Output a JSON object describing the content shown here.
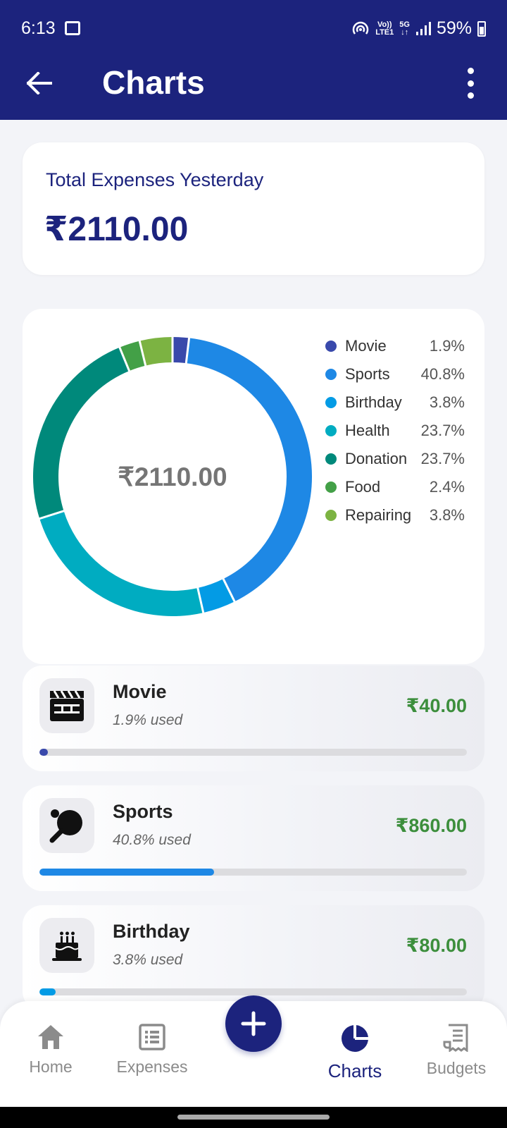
{
  "status_bar": {
    "time": "6:13",
    "network_top": "Vo))",
    "network_bottom": "LTE1",
    "gen_top": "5G",
    "gen_bottom": "↓↑",
    "battery": "59%"
  },
  "header": {
    "title": "Charts"
  },
  "summary": {
    "label": "Total Expenses Yesterday",
    "amount": "₹2110.00"
  },
  "chart_data": {
    "type": "pie",
    "center_label": "₹2110.00",
    "categories": [
      "Movie",
      "Sports",
      "Birthday",
      "Health",
      "Donation",
      "Food",
      "Repairing"
    ],
    "values": [
      1.9,
      40.8,
      3.8,
      23.7,
      23.7,
      2.4,
      3.8
    ],
    "labels": [
      "1.9%",
      "40.8%",
      "3.8%",
      "23.7%",
      "23.7%",
      "2.4%",
      "3.8%"
    ],
    "colors": [
      "#3949ab",
      "#1e88e5",
      "#039be5",
      "#00acc1",
      "#00897b",
      "#43a047",
      "#7cb342"
    ],
    "legend_position": "right"
  },
  "categories": [
    {
      "name": "Movie",
      "used": "1.9% used",
      "amount": "₹40.00",
      "fraction": 0.019,
      "color": "#3949ab",
      "icon": "clapperboard-icon"
    },
    {
      "name": "Sports",
      "used": "40.8% used",
      "amount": "₹860.00",
      "fraction": 0.408,
      "color": "#1e88e5",
      "icon": "table-tennis-icon"
    },
    {
      "name": "Birthday",
      "used": "3.8% used",
      "amount": "₹80.00",
      "fraction": 0.038,
      "color": "#039be5",
      "icon": "cake-icon"
    }
  ],
  "nav": {
    "home": "Home",
    "expenses": "Expenses",
    "charts": "Charts",
    "budgets": "Budgets",
    "active": "charts"
  }
}
